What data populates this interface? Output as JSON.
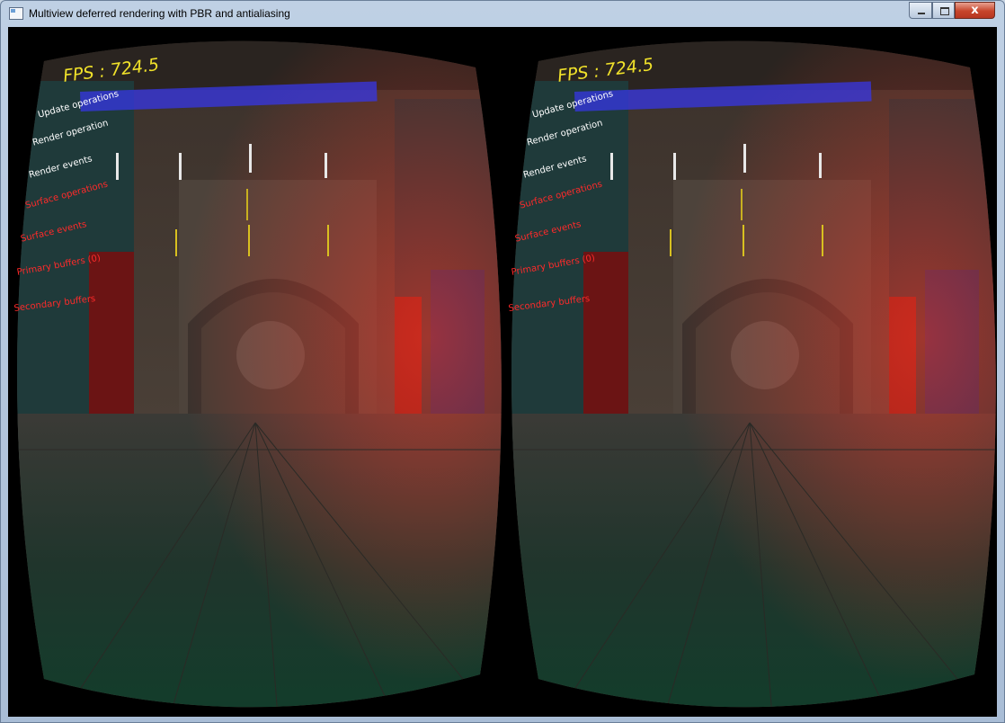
{
  "window": {
    "title": "Multiview deferred rendering with PBR and antialiasing",
    "icon": "app-window-icon",
    "controls": [
      "minimize-icon",
      "maximize-icon",
      "close-icon"
    ],
    "close_glyph": "x"
  },
  "hud": {
    "fps": "FPS : 724.5",
    "labels": [
      {
        "text": "Update operations",
        "color": "#ffffff"
      },
      {
        "text": "Render operation",
        "color": "#ffffff"
      },
      {
        "text": "Render events",
        "color": "#ffffff"
      },
      {
        "text": "Surface operations",
        "color": "#ff2a2a"
      },
      {
        "text": "Surface events",
        "color": "#ff2a2a"
      },
      {
        "text": "Primary buffers (0)",
        "color": "#ff2a2a"
      },
      {
        "text": "Secondary buffers",
        "color": "#ff2a2a"
      }
    ]
  },
  "colors": {
    "fps_text": "#f0e12a",
    "hud_bar": "#3737e6",
    "hud_white": "#ffffff",
    "hud_red": "#ff2a2a"
  }
}
